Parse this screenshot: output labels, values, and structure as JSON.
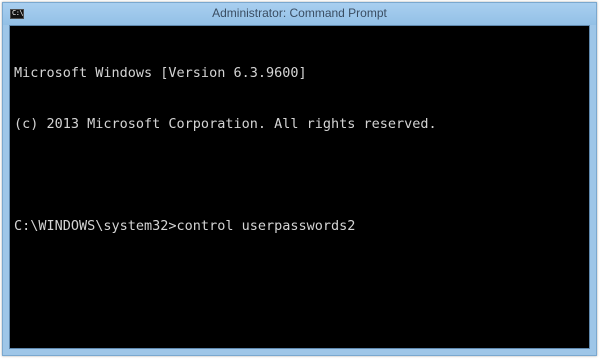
{
  "window": {
    "title": "Administrator: Command Prompt",
    "icon": "cmd-icon",
    "icon_glyph": "C:\\",
    "border_color": "#9ec6e8",
    "console_background": "#000000",
    "console_text_color": "#d4d4d4"
  },
  "console": {
    "lines": [
      "Microsoft Windows [Version 6.3.9600]",
      "(c) 2013 Microsoft Corporation. All rights reserved.",
      "",
      "C:\\WINDOWS\\system32>control userpasswords2"
    ]
  }
}
